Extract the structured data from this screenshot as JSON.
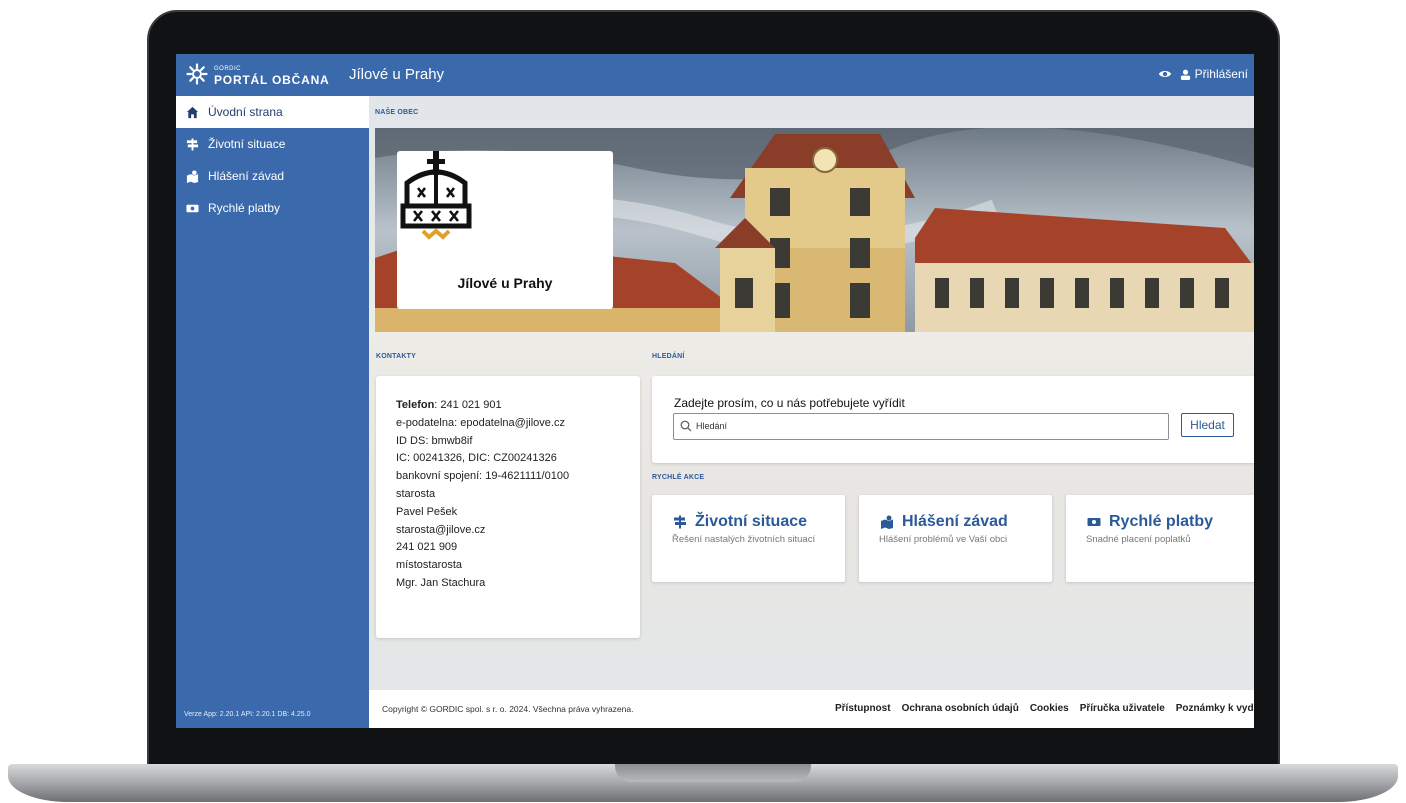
{
  "app": {
    "brand_small": "GORDIC",
    "brand_name": "PORTÁL OBČANA",
    "title": "Jílové u Prahy",
    "login_label": "Přihlášení"
  },
  "sidebar": {
    "items": [
      {
        "label": "Úvodní strana",
        "icon": "home-icon"
      },
      {
        "label": "Životní situace",
        "icon": "signpost-icon"
      },
      {
        "label": "Hlášení závad",
        "icon": "report-icon"
      },
      {
        "label": "Rychlé platby",
        "icon": "money-icon"
      }
    ],
    "version": "Verze App: 2.20.1 API: 2.20.1 DB: 4.25.0"
  },
  "main": {
    "section_obec": "NAŠE OBEC",
    "hero_name": "Jílové u Prahy",
    "section_contacts": "KONTAKTY",
    "section_search": "HLEDÁNÍ",
    "section_actions": "RYCHLÉ AKCE"
  },
  "contacts": {
    "phone_label": "Telefon",
    "phone_value": ": 241 021 901",
    "lines": [
      "e-podatelna: epodatelna@jilove.cz",
      "ID DS: bmwb8if",
      "IC: 00241326, DIC: CZ00241326",
      "bankovní spojení: 19-4621111/0100",
      "starosta",
      "Pavel Pešek",
      "starosta@jilove.cz",
      "241 021 909",
      "místostarosta",
      "Mgr. Jan Stachura"
    ]
  },
  "search": {
    "question": "Zadejte prosím, co u nás potřebujete vyřídit",
    "placeholder": "Hledání",
    "button": "Hledat"
  },
  "actions": [
    {
      "title": "Životní situace",
      "desc": "Řešení nastalých životních situací",
      "icon": "signpost-icon"
    },
    {
      "title": "Hlášení závad",
      "desc": "Hlášení problémů ve Vaší obci",
      "icon": "report-icon"
    },
    {
      "title": "Rychlé platby",
      "desc": "Snadné placení poplatků",
      "icon": "money-icon"
    }
  ],
  "footer": {
    "copyright": "Copyright © GORDIC spol. s r. o. 2024. Všechna práva vyhrazena.",
    "links": [
      "Přístupnost",
      "Ochrana osobních údajů",
      "Cookies",
      "Příručka uživatele",
      "Poznámky k vydání"
    ]
  },
  "colors": {
    "primary": "#3a6aab",
    "accent": "#2b5a98",
    "crown_gold": "#e0a02a"
  }
}
